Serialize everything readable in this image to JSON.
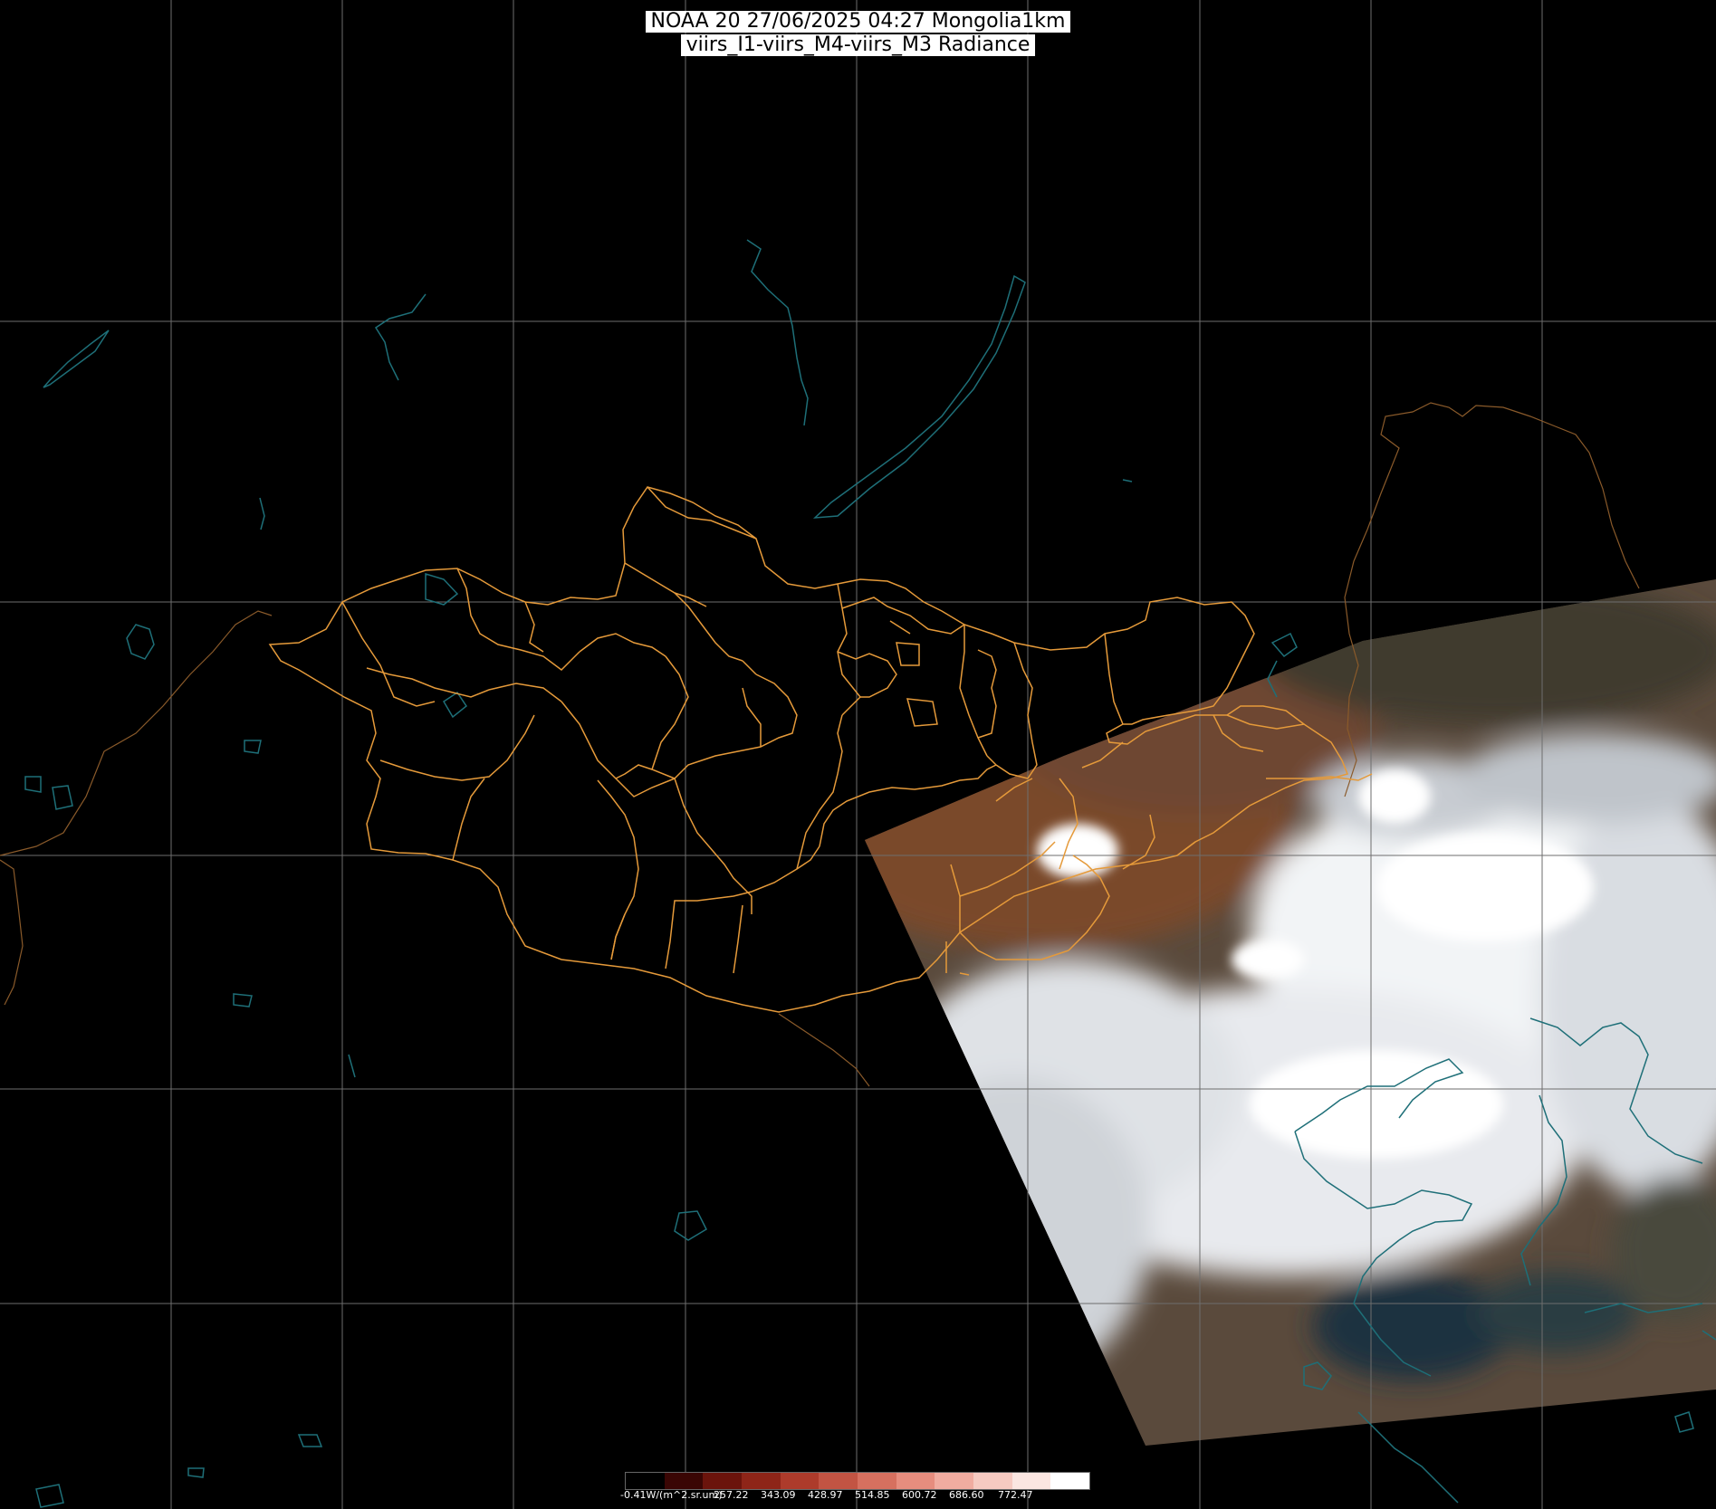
{
  "title": {
    "line1": "NOAA 20 27/06/2025 04:27 Mongolia1km",
    "line2": "viirs_I1-viirs_M4-viirs_M3 Radiance"
  },
  "colorbar": {
    "colors": [
      "#000000",
      "#3a0604",
      "#6b140c",
      "#8e2518",
      "#ad3b2b",
      "#c25443",
      "#d6705f",
      "#e68d7e",
      "#f0aca0",
      "#f6cac1",
      "#fbe6e1",
      "#ffffff"
    ],
    "labels": [
      "-0.41W/(m^2.sr.um)",
      "257.22",
      "343.09",
      "428.97",
      "514.85",
      "600.72",
      "686.60",
      "772.47"
    ]
  },
  "map": {
    "background_color": "#000000",
    "grid_color": "#6e6e6e",
    "border_color": "#e59a3a",
    "water_color": "#1e6f78",
    "land_color": "#7a4a2c",
    "cloud_color": "#ffffff",
    "sea_color": "#1c3340"
  }
}
